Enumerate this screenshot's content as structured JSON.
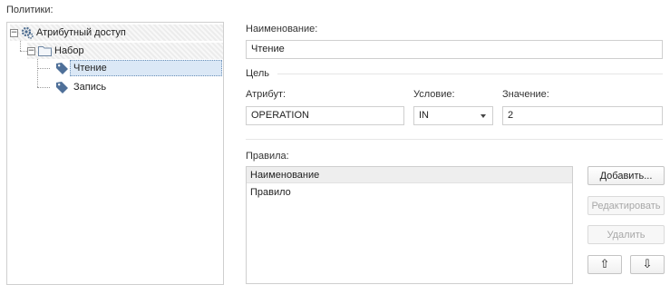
{
  "policies_label": "Политики:",
  "tree": {
    "root_label": "Атрибутный доступ",
    "set_label": "Набор",
    "items": [
      "Чтение",
      "Запись"
    ]
  },
  "name_label": "Наименование:",
  "name_value": "Чтение",
  "target_label": "Цель",
  "attribute_label": "Атрибут:",
  "attribute_value": "OPERATION",
  "condition_label": "Условие:",
  "condition_value": "IN",
  "value_label": "Значение:",
  "value_value": "2",
  "rules_label": "Правила:",
  "rules_grid": {
    "header": "Наименование",
    "rows": [
      "Правило"
    ]
  },
  "buttons": {
    "add": "Добавить...",
    "edit": "Редактировать",
    "delete": "Удалить",
    "up": "⇧",
    "down": "⇩"
  }
}
